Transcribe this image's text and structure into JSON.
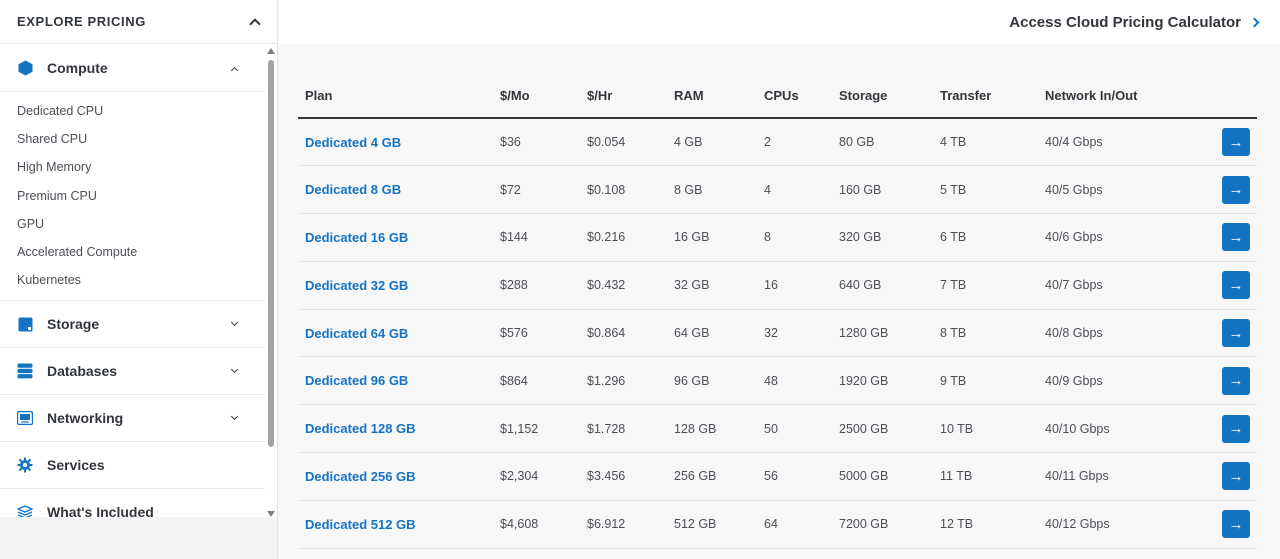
{
  "sidebar": {
    "title": "EXPLORE PRICING",
    "categories": {
      "compute": {
        "label": "Compute",
        "icon": "hexagon-icon"
      },
      "storage": {
        "label": "Storage",
        "icon": "storage-icon"
      },
      "databases": {
        "label": "Databases",
        "icon": "database-icon"
      },
      "networking": {
        "label": "Networking",
        "icon": "network-icon"
      },
      "services": {
        "label": "Services",
        "icon": "gear-icon"
      },
      "whats_included": {
        "label": "What's Included",
        "icon": "layers-icon"
      }
    },
    "compute_items": [
      "Dedicated CPU",
      "Shared CPU",
      "High Memory",
      "Premium CPU",
      "GPU",
      "Accelerated Compute",
      "Kubernetes"
    ]
  },
  "header": {
    "calculator_link": "Access Cloud Pricing Calculator"
  },
  "table": {
    "headers": [
      "Plan",
      "$/Mo",
      "$/Hr",
      "RAM",
      "CPUs",
      "Storage",
      "Transfer",
      "Network In/Out"
    ],
    "rows": [
      [
        "Dedicated 4 GB",
        "$36",
        "$0.054",
        "4 GB",
        "2",
        "80 GB",
        "4 TB",
        "40/4 Gbps"
      ],
      [
        "Dedicated 8 GB",
        "$72",
        "$0.108",
        "8 GB",
        "4",
        "160 GB",
        "5 TB",
        "40/5 Gbps"
      ],
      [
        "Dedicated 16 GB",
        "$144",
        "$0.216",
        "16 GB",
        "8",
        "320 GB",
        "6 TB",
        "40/6 Gbps"
      ],
      [
        "Dedicated 32 GB",
        "$288",
        "$0.432",
        "32 GB",
        "16",
        "640 GB",
        "7 TB",
        "40/7 Gbps"
      ],
      [
        "Dedicated 64 GB",
        "$576",
        "$0.864",
        "64 GB",
        "32",
        "1280 GB",
        "8 TB",
        "40/8 Gbps"
      ],
      [
        "Dedicated 96 GB",
        "$864",
        "$1.296",
        "96 GB",
        "48",
        "1920 GB",
        "9 TB",
        "40/9 Gbps"
      ],
      [
        "Dedicated 128 GB",
        "$1,152",
        "$1.728",
        "128 GB",
        "50",
        "2500 GB",
        "10 TB",
        "40/10 Gbps"
      ],
      [
        "Dedicated 256 GB",
        "$2,304",
        "$3.456",
        "256 GB",
        "56",
        "5000 GB",
        "11 TB",
        "40/11 Gbps"
      ],
      [
        "Dedicated 512 GB",
        "$4,608",
        "$6.912",
        "512 GB",
        "64",
        "7200 GB",
        "12 TB",
        "40/12 Gbps"
      ]
    ],
    "row_action_icon": "arrow-right-icon"
  },
  "colors": {
    "accent": "#1474c4",
    "text": "#32363c"
  }
}
